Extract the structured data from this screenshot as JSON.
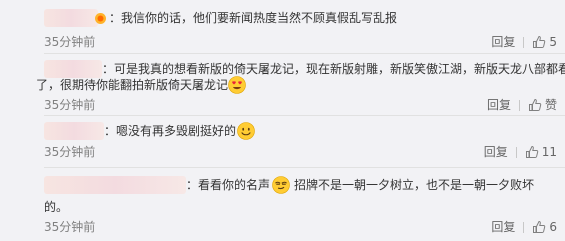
{
  "comments": [
    {
      "text": "我信你的话，他们要新闻热度当然不顾真假乱写乱报",
      "time": "35分钟前",
      "reply_label": "回复",
      "like_count": "5"
    },
    {
      "text_line1": "可是我真的想看新版的倚天屠龙记，现在新版射雕，新版笑傲江湖，新版天龙八部都看",
      "text_line2": "了，很期待你能翻拍新版倚天屠龙记",
      "time": "35分钟前",
      "reply_label": "回复",
      "like_label": "赞"
    },
    {
      "text": "嗯没有再多毁剧挺好的",
      "time": "35分钟前",
      "reply_label": "回复",
      "like_count": "11"
    },
    {
      "text_part1": "看看你的名声",
      "text_part2": "招牌不是一朝一夕树立，也不是一朝一夕败坏",
      "text_line2": "的。",
      "time": "35分钟前",
      "reply_label": "回复",
      "like_count": "6"
    }
  ],
  "colors": {
    "background": "#f2f2f5",
    "text": "#333333",
    "time": "#808080",
    "action": "#666666",
    "emoji_yellow": "#ffcc33"
  },
  "icons": {
    "like": "thumbs-up-icon",
    "emoji_heart_eyes": "heart-eyes-emoji-icon",
    "emoji_smile": "smile-emoji-icon",
    "emoji_smirk": "smirk-emoji-icon",
    "user_badge": "user-badge-icon"
  }
}
